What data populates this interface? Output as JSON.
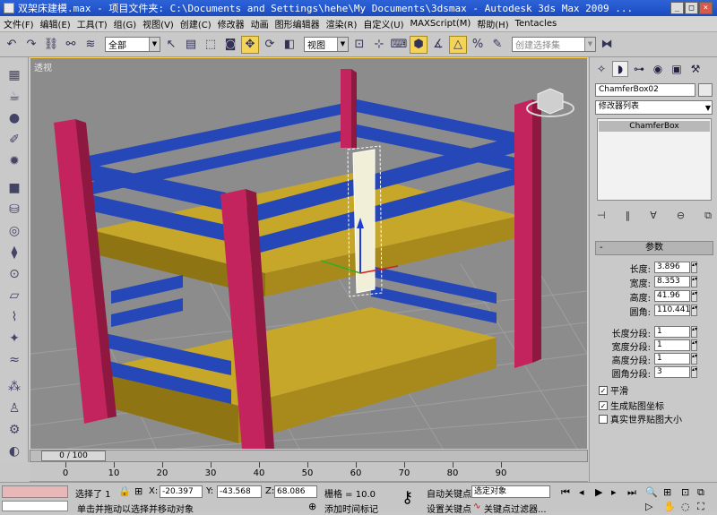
{
  "window": {
    "title": "双架床建模.max    - 项目文件夹: C:\\Documents and Settings\\hehe\\My Documents\\3dsmax    - Autodesk 3ds Max  2009 ..."
  },
  "menu": [
    "文件(F)",
    "编辑(E)",
    "工具(T)",
    "组(G)",
    "视图(V)",
    "创建(C)",
    "修改器",
    "动画",
    "图形编辑器",
    "渲染(R)",
    "自定义(U)",
    "MAXScript(M)",
    "帮助(H)",
    "Tentacles"
  ],
  "toolbar": {
    "selection_filter": "全部",
    "reference_coord": "视图",
    "named_selection_placeholder": "创建选择集"
  },
  "viewport": {
    "label": "透视"
  },
  "timeline": {
    "slider_label": "0 / 100",
    "ticks": [
      "0",
      "10",
      "20",
      "30",
      "40",
      "50",
      "60",
      "70",
      "80",
      "90"
    ]
  },
  "command_panel": {
    "object_name": "ChamferBox02",
    "modifier_list": "修改器列表",
    "stack_item": "ChamferBox",
    "rollout_title": "参数",
    "params": [
      {
        "label": "长度:",
        "value": "3.896"
      },
      {
        "label": "宽度:",
        "value": "8.353"
      },
      {
        "label": "高度:",
        "value": "41.96"
      },
      {
        "label": "圆角:",
        "value": "110.441"
      }
    ],
    "segments": [
      {
        "label": "长度分段:",
        "value": "1"
      },
      {
        "label": "宽度分段:",
        "value": "1"
      },
      {
        "label": "高度分段:",
        "value": "1"
      },
      {
        "label": "圆角分段:",
        "value": "3"
      }
    ],
    "options": [
      {
        "label": "平滑",
        "checked": true
      },
      {
        "label": "生成贴图坐标",
        "checked": true
      },
      {
        "label": "真实世界贴图大小",
        "checked": false
      }
    ]
  },
  "status": {
    "selected": "选择了 1",
    "x_label": "X:",
    "x": "-20.397",
    "y_label": "Y:",
    "y": "-43.568",
    "z_label": "Z:",
    "z": "68.086",
    "grid": "栅格 = 10.0",
    "autokey": "自动关键点",
    "selected_object": "选定对象",
    "prompt": "单击并拖动以选择并移动对象",
    "add_time_tag": "添加时间标记",
    "set_key": "设置关键点",
    "key_filters": "关键点过滤器..."
  },
  "colors": {
    "post": "#c4245e",
    "rail": "#2547b8",
    "platform": "#b89a20",
    "viewport_bg": "#8c8c8c",
    "active_border": "#ffd24a"
  }
}
